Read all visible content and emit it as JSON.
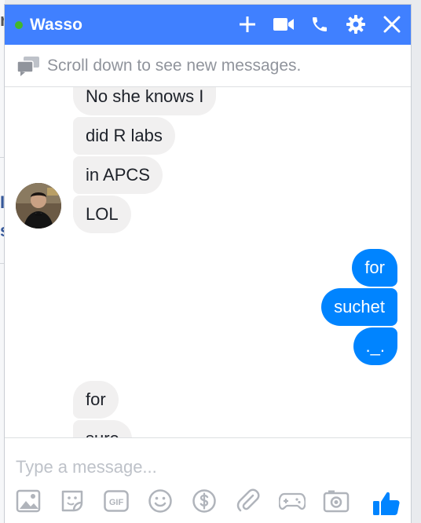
{
  "chat": {
    "title": "Wasso",
    "online": true,
    "icons": [
      "add-person-icon",
      "video-call-icon",
      "phone-call-icon",
      "settings-gear-icon",
      "close-icon"
    ]
  },
  "notice": {
    "text": "Scroll down to see new messages."
  },
  "messages": [
    {
      "sender": "them",
      "text": "No she knows I"
    },
    {
      "sender": "them",
      "text": "did R labs"
    },
    {
      "sender": "them",
      "text": "in APCS"
    },
    {
      "sender": "them",
      "text": "LOL"
    },
    {
      "sender": "me",
      "text": "for"
    },
    {
      "sender": "me",
      "text": "suchet"
    },
    {
      "sender": "me",
      "text": "._."
    },
    {
      "sender": "them",
      "text": "for"
    },
    {
      "sender": "them",
      "text": "sure"
    }
  ],
  "composer": {
    "placeholder": "Type a message...",
    "tools": [
      "photo-icon",
      "sticker-icon",
      "gif-icon",
      "emoji-icon",
      "payment-dollar-icon",
      "attachment-paperclip-icon",
      "game-controller-icon",
      "camera-icon"
    ],
    "gif_label": "GIF",
    "send_icon": "thumbs-up-icon"
  },
  "colors": {
    "header": "#4080ff",
    "outgoing": "#0084ff",
    "incoming": "#f1f0f0",
    "online": "#42b72a"
  }
}
